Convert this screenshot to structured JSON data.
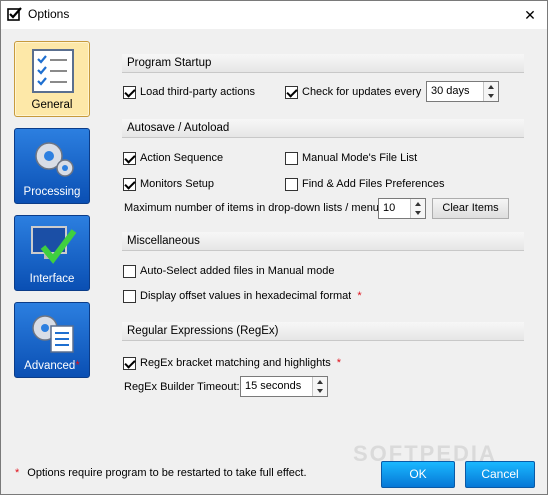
{
  "window": {
    "title": "Options",
    "close_glyph": "✕"
  },
  "nav": [
    {
      "label": "General",
      "star": ""
    },
    {
      "label": "Processing",
      "star": ""
    },
    {
      "label": "Interface",
      "star": ""
    },
    {
      "label": "Advanced",
      "star": "*"
    }
  ],
  "sections": {
    "startup": {
      "header": "Program Startup",
      "load_third_party": {
        "label": "Load third-party actions",
        "checked": true
      },
      "check_updates": {
        "label": "Check for updates every",
        "checked": true
      },
      "update_interval": "30 days"
    },
    "autosave": {
      "header": "Autosave / Autoload",
      "action_sequence": {
        "label": "Action Sequence",
        "checked": true
      },
      "monitors_setup": {
        "label": "Monitors Setup",
        "checked": true
      },
      "manual_file_list": {
        "label": "Manual Mode's File List",
        "checked": false
      },
      "find_add_prefs": {
        "label": "Find & Add Files Preferences",
        "checked": false
      },
      "max_items_label": "Maximum number of items in drop-down lists / menus:",
      "max_items_value": "10",
      "clear_items": "Clear Items"
    },
    "misc": {
      "header": "Miscellaneous",
      "auto_select": {
        "label": "Auto-Select added files in Manual mode",
        "checked": false
      },
      "hex_offsets": {
        "label": "Display offset values in hexadecimal format",
        "checked": false
      }
    },
    "regex": {
      "header": "Regular Expressions (RegEx)",
      "bracket_matching": {
        "label": "RegEx bracket matching and highlights",
        "checked": true
      },
      "timeout_label": "RegEx Builder Timeout:",
      "timeout_value": "15 seconds"
    }
  },
  "footer": {
    "star": "*",
    "note": "Options require program to be restarted to take full effect.",
    "ok": "OK",
    "cancel": "Cancel"
  },
  "watermark": "SOFTPEDIA",
  "colors": {
    "accent_blue": "#0677d6",
    "active_nav": "#fde8a8",
    "star_red": "#e0101a"
  }
}
